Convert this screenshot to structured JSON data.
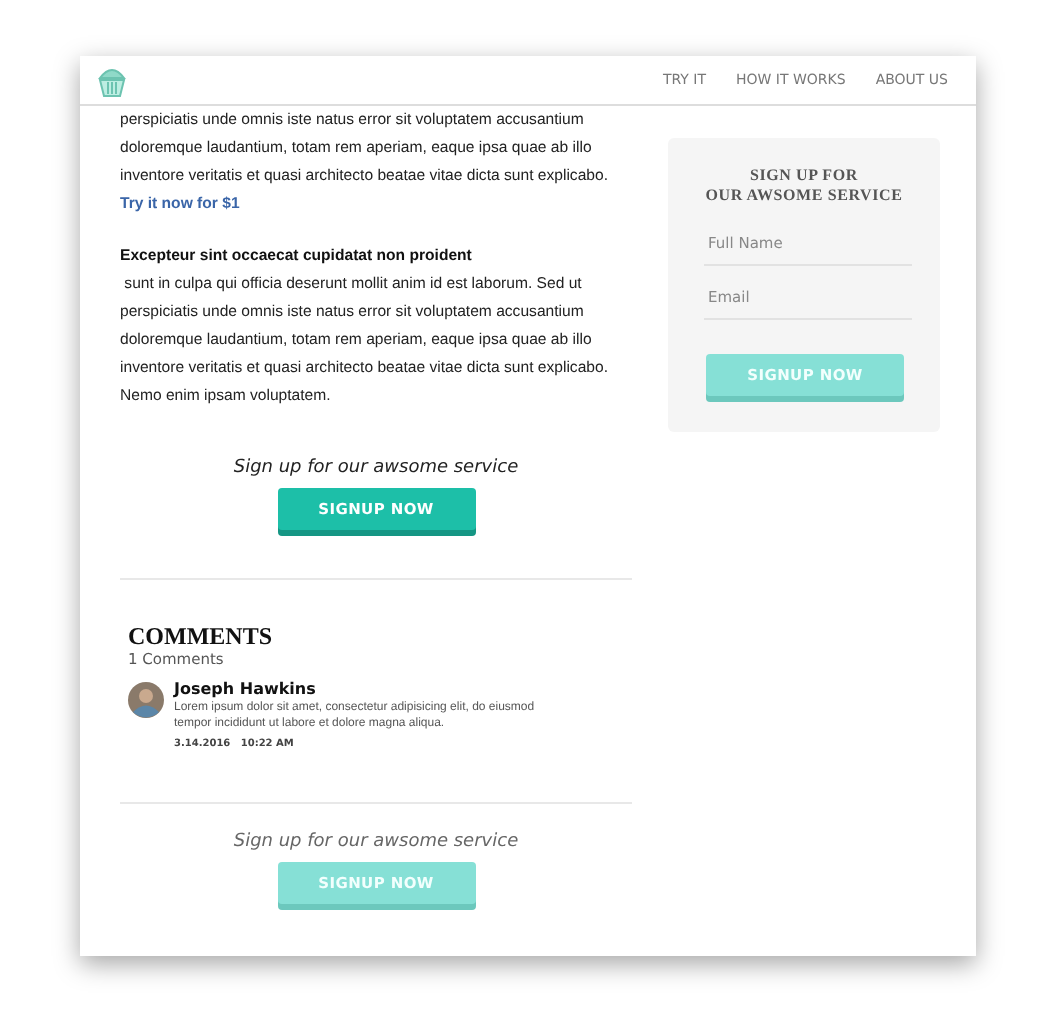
{
  "header": {
    "nav": [
      {
        "label": "TRY IT"
      },
      {
        "label": "HOW IT WORKS"
      },
      {
        "label": "ABOUT US"
      }
    ]
  },
  "article": {
    "paragraphs": [
      {
        "lines": [
          "perspiciatis unde omnis iste natus error sit voluptatem accusantium",
          "doloremque laudantium, totam rem aperiam, eaque ipsa quae ab illo",
          "inventore veritatis et quasi architecto beatae vitae dicta sunt explicabo."
        ],
        "link": "Try it now for $1"
      },
      {
        "heading": "Excepteur sint occaecat cupidatat non proident",
        "lines": [
          " sunt in culpa qui officia deserunt mollit anim id est laborum. Sed ut",
          "perspiciatis unde omnis iste natus error sit voluptatem accusantium",
          "doloremque laudantium, totam rem aperiam, eaque ipsa quae ab illo",
          "inventore veritatis et quasi architecto beatae vitae dicta sunt explicabo.",
          "Nemo enim ipsam voluptatem."
        ]
      }
    ],
    "cta": {
      "prompt": "Sign up for our awsome service",
      "button": "SIGNUP NOW",
      "disabled": false
    }
  },
  "comments": {
    "title": "COMMENTS",
    "count": "1 Comments",
    "items": [
      {
        "author": "Joseph Hawkins",
        "lines": [
          "Lorem ipsum dolor sit amet, consectetur adipisicing elit, do eiusmod",
          "tempor incididunt ut labore et dolore magna aliqua."
        ],
        "timestamp": "3.14.2016   10:22 AM"
      }
    ]
  },
  "bottom_cta": {
    "prompt": "Sign up for our awsome service",
    "button": "SIGNUP NOW",
    "disabled": true
  },
  "sidebar": {
    "title_lines": [
      "SIGN UP FOR",
      "OUR AWSOME SERVICE"
    ],
    "fields": [
      {
        "placeholder": "Full Name"
      },
      {
        "placeholder": "Email"
      }
    ],
    "button": {
      "label": "SIGNUP NOW",
      "disabled": true
    }
  }
}
